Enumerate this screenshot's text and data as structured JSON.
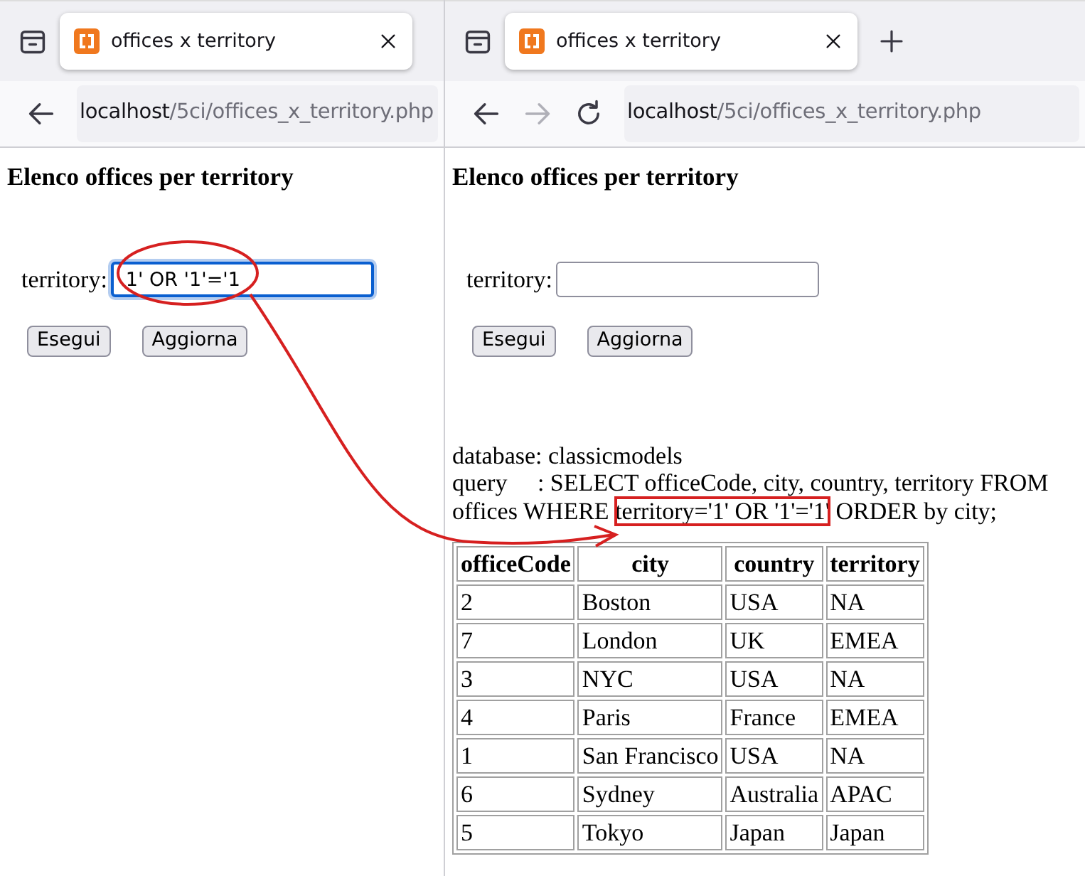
{
  "panes": [
    {
      "tab": {
        "title": "offices x territory"
      },
      "new_tab_button": false,
      "nav_buttons": [
        {
          "kind": "back",
          "disabled": false
        }
      ],
      "url": {
        "host": "localhost",
        "path": "/5ci/offices_x_territory.php"
      },
      "page": {
        "heading": "Elenco offices per territory",
        "field": {
          "label": "territory:",
          "value": "1' OR '1'='1",
          "focused": true
        },
        "buttons": [
          "Esegui",
          "Aggiorna"
        ]
      }
    },
    {
      "tab": {
        "title": "offices x territory"
      },
      "new_tab_button": true,
      "nav_buttons": [
        {
          "kind": "back",
          "disabled": false
        },
        {
          "kind": "forward",
          "disabled": true
        },
        {
          "kind": "reload",
          "disabled": false
        }
      ],
      "url": {
        "host": "localhost",
        "path": "/5ci/offices_x_territory.php"
      },
      "page": {
        "heading": "Elenco offices per territory",
        "field": {
          "label": "territory:",
          "focused": false
        },
        "buttons": [
          "Esegui",
          "Aggiorna"
        ],
        "result": {
          "database": "database: classicmodels",
          "query_before": "query     : SELECT officeCode, city, country, territory FROM offices WHERE ",
          "query_highlight": "territory='1' OR '1'='1'",
          "query_after": " ORDER by city;",
          "table": {
            "columns": [
              "officeCode",
              "city",
              "country",
              "territory"
            ],
            "rows": [
              [
                "2",
                "Boston",
                "USA",
                "NA"
              ],
              [
                "7",
                "London",
                "UK",
                "EMEA"
              ],
              [
                "3",
                "NYC",
                "USA",
                "NA"
              ],
              [
                "4",
                "Paris",
                "France",
                "EMEA"
              ],
              [
                "1",
                "San Francisco",
                "USA",
                "NA"
              ],
              [
                "6",
                "Sydney",
                "Australia",
                "APAC"
              ],
              [
                "5",
                "Tokyo",
                "Japan",
                "Japan"
              ]
            ]
          }
        }
      }
    }
  ]
}
